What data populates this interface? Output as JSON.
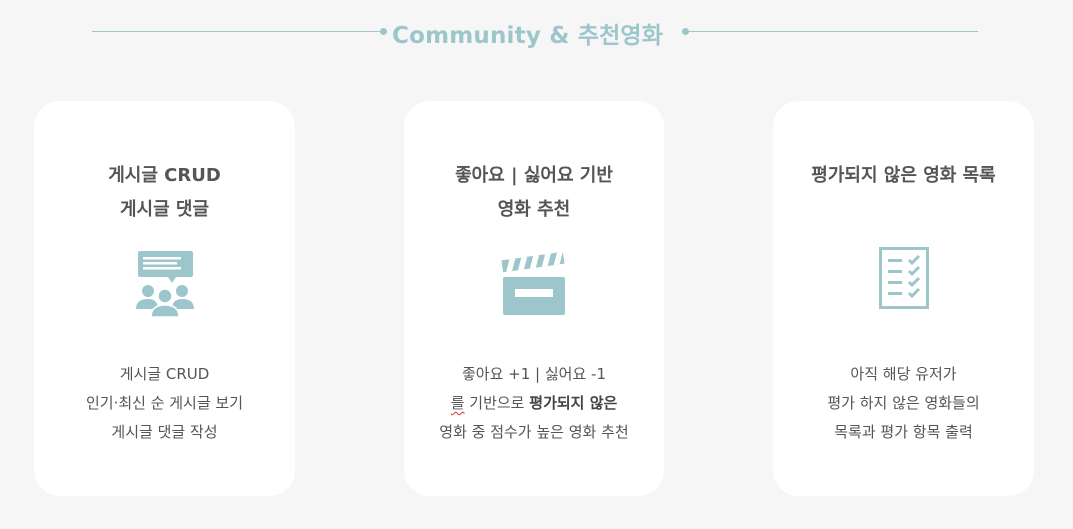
{
  "section": {
    "title": "Community & 추천영화"
  },
  "colors": {
    "accent": "#9cc6cb",
    "background": "#f6f6f6",
    "card": "#ffffff",
    "text": "#555555"
  },
  "cards": [
    {
      "icon": "community-chat-icon",
      "title_lines": [
        "게시글 CRUD",
        "게시글 댓글"
      ],
      "desc_lines": [
        "게시글 CRUD",
        "인기·최신 순 게시글 보기",
        "게시글 댓글 작성"
      ]
    },
    {
      "icon": "clapperboard-icon",
      "title_lines": [
        "좋아요 | 싫어요 기반",
        "영화 추천"
      ],
      "desc_line1": "좋아요 +1 | 싫어요 -1",
      "desc_line2_prefix": "를",
      "desc_line2_mid": " 기반으로 ",
      "desc_line2_bold": "평가되지 않은",
      "desc_line3": "영화 중 점수가 높은 영화 추천"
    },
    {
      "icon": "checklist-icon",
      "title_lines": [
        "평가되지 않은 영화 목록"
      ],
      "desc_lines": [
        "아직 해당 유저가",
        "평가 하지 않은 영화들의",
        "목록과 평가 항목 출력"
      ]
    }
  ]
}
